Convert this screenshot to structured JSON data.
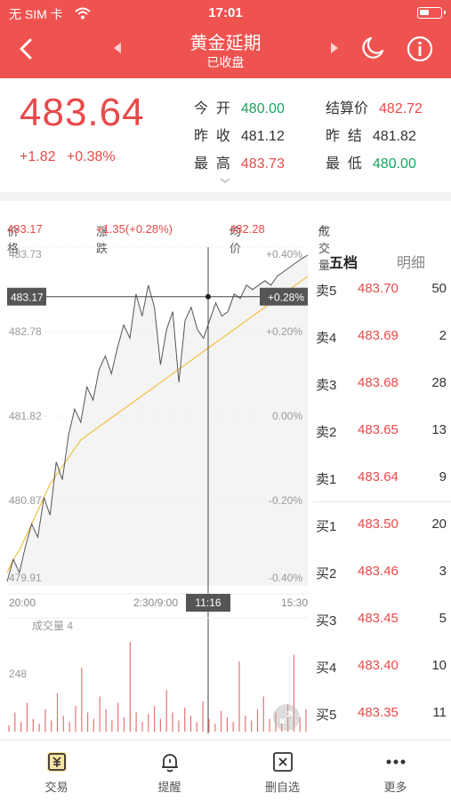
{
  "status_bar": {
    "carrier": "无 SIM 卡",
    "time": "17:01"
  },
  "header": {
    "title": "黄金延期",
    "subtitle": "已收盘"
  },
  "quote": {
    "price": "483.64",
    "change": "+1.82",
    "change_pct": "+0.38%",
    "stats": [
      {
        "label": "今  开",
        "value": "480.00",
        "color": "#1aa260"
      },
      {
        "label": "结算价",
        "value": "482.72",
        "color": "#e84a4a"
      },
      {
        "label": "昨  收",
        "value": "481.12",
        "color": "#333333"
      },
      {
        "label": "昨  结",
        "value": "481.82",
        "color": "#333333"
      },
      {
        "label": "最  高",
        "value": "483.73",
        "color": "#e84a4a"
      },
      {
        "label": "最  低",
        "value": "480.00",
        "color": "#1aa260"
      }
    ]
  },
  "info_bar": {
    "price_label": "价格",
    "price_value": "483.17",
    "change_label": "涨跌",
    "change_value": "+1.35(+0.28%)",
    "avg_label": "均价",
    "avg_value": "482.28",
    "volume_label": "成交量",
    "volume_value": "4"
  },
  "chart_data": {
    "type": "line",
    "title": "",
    "y_price_ticks": [
      "483.73",
      "482.78",
      "481.82",
      "480.87",
      "479.91"
    ],
    "y_pct_ticks": [
      "+0.40%",
      "+0.20%",
      "0.00%",
      "-0.20%",
      "-0.40%"
    ],
    "x_ticks": [
      "20:00",
      "2:30/9:00",
      "15:30"
    ],
    "crosshair": {
      "time": "11:16",
      "price": "483.17",
      "pct": "+0.28%"
    },
    "ylim": [
      479.91,
      483.73
    ],
    "price_series": [
      479.95,
      480.2,
      480.05,
      480.35,
      480.6,
      480.45,
      480.9,
      480.7,
      481.3,
      481.1,
      481.6,
      481.9,
      481.75,
      482.15,
      482.0,
      482.35,
      482.5,
      482.3,
      482.6,
      482.85,
      482.7,
      483.2,
      482.95,
      483.3,
      483.05,
      482.4,
      482.8,
      483.0,
      482.2,
      482.9,
      483.05,
      482.8,
      482.7,
      482.9,
      483.1,
      482.95,
      483.0,
      483.2,
      483.15,
      483.3,
      483.25,
      483.3,
      483.35,
      483.3,
      483.4,
      483.45,
      483.5,
      483.55,
      483.6,
      483.64
    ],
    "avg_series": [
      480.05,
      480.2,
      480.3,
      480.45,
      480.6,
      480.75,
      480.9,
      481.05,
      481.15,
      481.25,
      481.35,
      481.45,
      481.55,
      481.6,
      481.65,
      481.7,
      481.75,
      481.8,
      481.85,
      481.9,
      481.95,
      482.0,
      482.05,
      482.1,
      482.15,
      482.2,
      482.25,
      482.3,
      482.35,
      482.4,
      482.45,
      482.5,
      482.55,
      482.6,
      482.65,
      482.7,
      482.75,
      482.8,
      482.85,
      482.9,
      482.95,
      483.0,
      483.05,
      483.1,
      483.15,
      483.2,
      483.25,
      483.3,
      483.35,
      483.4
    ],
    "volume_label": "成交量 4",
    "volume_tick": "248",
    "volume_series": [
      20,
      60,
      30,
      90,
      40,
      25,
      70,
      35,
      120,
      50,
      30,
      80,
      200,
      60,
      40,
      110,
      70,
      35,
      90,
      45,
      280,
      60,
      30,
      55,
      80,
      40,
      130,
      60,
      35,
      75,
      50,
      30,
      95,
      40,
      25,
      65,
      45,
      30,
      220,
      50,
      35,
      70,
      110,
      40,
      60,
      30,
      85,
      240,
      45,
      70
    ],
    "colors": {
      "price_line": "#555555",
      "avg_line": "#f2c040",
      "fill": "#f4f4f4",
      "volume": "#e57373"
    }
  },
  "order_book": {
    "tab_active": "五档",
    "tab_inactive": "明细",
    "sells": [
      {
        "label": "卖5",
        "price": "483.70",
        "qty": "50"
      },
      {
        "label": "卖4",
        "price": "483.69",
        "qty": "2"
      },
      {
        "label": "卖3",
        "price": "483.68",
        "qty": "28"
      },
      {
        "label": "卖2",
        "price": "483.65",
        "qty": "13"
      },
      {
        "label": "卖1",
        "price": "483.64",
        "qty": "9"
      }
    ],
    "buys": [
      {
        "label": "买1",
        "price": "483.50",
        "qty": "20"
      },
      {
        "label": "买2",
        "price": "483.46",
        "qty": "3"
      },
      {
        "label": "买3",
        "price": "483.45",
        "qty": "5"
      },
      {
        "label": "买4",
        "price": "483.40",
        "qty": "10"
      },
      {
        "label": "买5",
        "price": "483.35",
        "qty": "11"
      }
    ]
  },
  "tab_bar": [
    {
      "label": "交易",
      "icon": "trade-icon"
    },
    {
      "label": "提醒",
      "icon": "bell-icon"
    },
    {
      "label": "删自选",
      "icon": "remove-watchlist-icon"
    },
    {
      "label": "更多",
      "icon": "more-icon"
    }
  ]
}
